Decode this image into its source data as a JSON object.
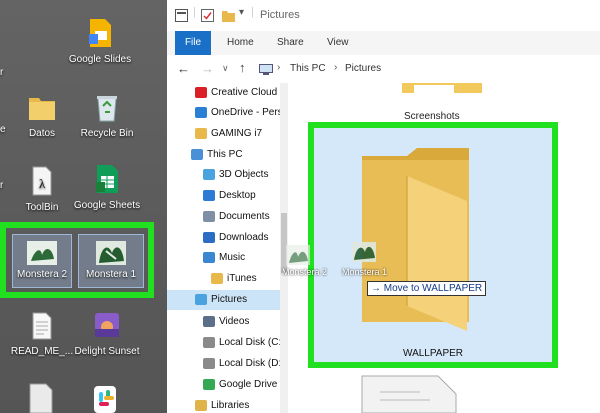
{
  "desktop": {
    "icons": [
      {
        "label": "Google Slides"
      },
      {
        "label": "Datos"
      },
      {
        "label": "Recycle Bin"
      },
      {
        "label": "ToolBin"
      },
      {
        "label": "Google Sheets"
      },
      {
        "label": "Monstera 2"
      },
      {
        "label": "Monstera 1"
      },
      {
        "label": "READ_ME_..."
      },
      {
        "label": "Delight Sunset"
      }
    ],
    "edge_fragments": [
      "r",
      "e",
      "r"
    ]
  },
  "explorer": {
    "title": "Pictures",
    "ribbon_tabs": [
      "File",
      "Home",
      "Share",
      "View"
    ],
    "breadcrumb": [
      "This PC",
      "Pictures"
    ],
    "nav_items": [
      {
        "label": "Creative Cloud F",
        "icon": "creative-cloud-icon"
      },
      {
        "label": "OneDrive - Perso",
        "icon": "onedrive-icon"
      },
      {
        "label": "GAMING i7",
        "icon": "user-folder-icon"
      },
      {
        "label": "This PC",
        "icon": "computer-icon"
      },
      {
        "label": "3D Objects",
        "icon": "3d-objects-icon"
      },
      {
        "label": "Desktop",
        "icon": "desktop-icon"
      },
      {
        "label": "Documents",
        "icon": "documents-icon"
      },
      {
        "label": "Downloads",
        "icon": "downloads-icon"
      },
      {
        "label": "Music",
        "icon": "music-icon"
      },
      {
        "label": "iTunes",
        "icon": "folder-icon"
      },
      {
        "label": "Pictures",
        "icon": "pictures-icon"
      },
      {
        "label": "Videos",
        "icon": "videos-icon"
      },
      {
        "label": "Local Disk (C:)",
        "icon": "drive-icon"
      },
      {
        "label": "Local Disk (D:)",
        "icon": "drive-icon"
      },
      {
        "label": "Google Drive (C",
        "icon": "google-drive-icon"
      },
      {
        "label": "Libraries",
        "icon": "libraries-icon"
      }
    ],
    "folders": [
      {
        "label": "Screenshots"
      },
      {
        "label": "WALLPAPER"
      }
    ],
    "drag": {
      "ghost_labels": [
        "Monstera 2",
        "Monstera 1"
      ],
      "tooltip": "Move to WALLPAPER"
    }
  },
  "colors": {
    "highlight_green": "#20e020",
    "file_tab_blue": "#1a6fc7",
    "folder_yellow": "#f2c95c",
    "drop_target_blue": "#d5e8f9",
    "selected_nav": "#cce4f7"
  }
}
